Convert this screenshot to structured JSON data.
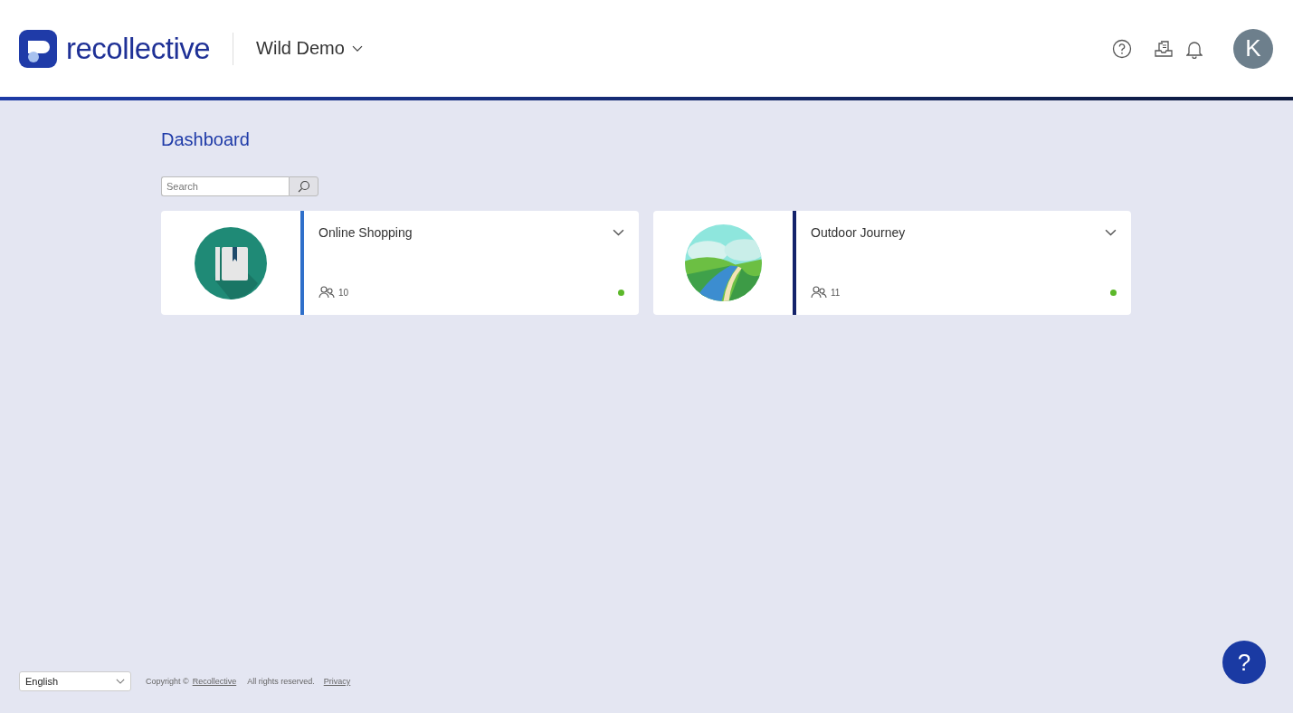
{
  "header": {
    "logo_text": "recollective",
    "workspace": "Wild Demo",
    "avatar_initial": "K"
  },
  "page_title": "Dashboard",
  "search": {
    "placeholder": "Search"
  },
  "projects": [
    {
      "title": "Online Shopping",
      "members": "10",
      "kind": "notebook",
      "color": "#2f6fca"
    },
    {
      "title": "Outdoor Journey",
      "members": "11",
      "kind": "landscape",
      "color": "#14236b"
    }
  ],
  "footer": {
    "language": "English",
    "copyright": "Copyright ©",
    "company_link": "Recollective",
    "rights": "All rights reserved.",
    "privacy_link": "Privacy"
  },
  "help_button": "?"
}
